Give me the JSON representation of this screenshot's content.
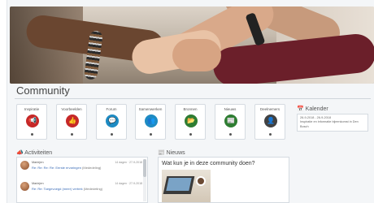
{
  "page": {
    "title": "Community"
  },
  "tiles": [
    {
      "label": "Inspiratie",
      "icon": "megaphone-icon",
      "glyph": "📢",
      "color": "#c62828"
    },
    {
      "label": "Voorbeelden",
      "icon": "thumbs-up-icon",
      "glyph": "👍",
      "color": "#c62828"
    },
    {
      "label": "Forum",
      "icon": "chat-icon",
      "glyph": "💬",
      "color": "#1e8bc3"
    },
    {
      "label": "Samenwerken",
      "icon": "users-icon",
      "glyph": "👥",
      "color": "#1e8bc3"
    },
    {
      "label": "Bronnen",
      "icon": "folder-icon",
      "glyph": "📂",
      "color": "#2e7d32"
    },
    {
      "label": "Nieuws",
      "icon": "newspaper-icon",
      "glyph": "📰",
      "color": "#2e7d32"
    },
    {
      "label": "Deelnemers",
      "icon": "person-icon",
      "glyph": "👤",
      "color": "#424242"
    }
  ],
  "calendar": {
    "heading": "Kalender",
    "icon": "calendar-icon",
    "date": "26-9-2018 - 26-9-2018",
    "event": "Inspiratie en informatie bijeenkomst in Den Bosch"
  },
  "activities": {
    "heading": "Activiteiten",
    "icon": "megaphone-icon",
    "items": [
      {
        "name": "Mariejen",
        "time": "14 dagen · 27-9-2018",
        "text": "Re: Re: Re: Re: Eerste ervaringen",
        "tag": "(Mededeling)"
      },
      {
        "name": "Mariejen",
        "time": "14 dagen · 27-9-2018",
        "text": "Re: Re: Toegevoegd (meer) vertrek",
        "tag": "(Mededeling)"
      }
    ]
  },
  "news": {
    "heading": "Nieuws",
    "icon": "newspaper-icon",
    "item_title": "Wat kun je in deze community doen?"
  },
  "colors": {
    "accent_red": "#c62828",
    "accent_blue": "#1e8bc3",
    "accent_green": "#2e7d32",
    "accent_dark": "#424242"
  }
}
